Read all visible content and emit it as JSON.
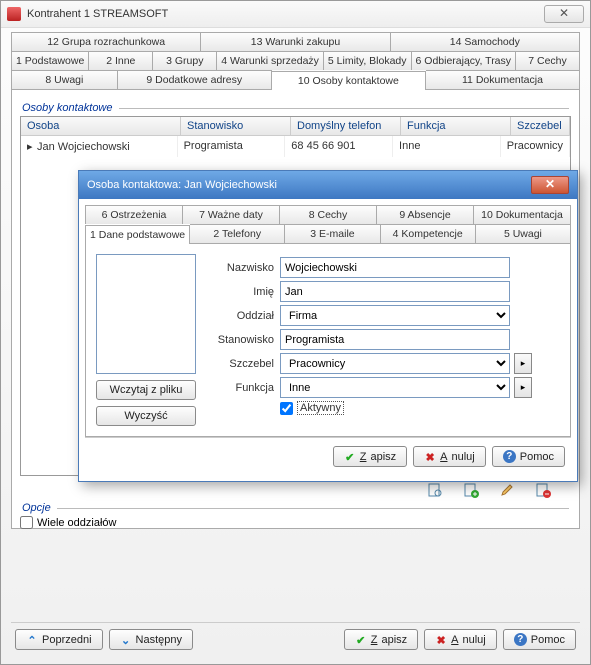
{
  "window": {
    "title": "Kontrahent  1  STREAMSOFT"
  },
  "tabs_row1": [
    "12 Grupa rozrachunkowa",
    "13 Warunki zakupu",
    "14 Samochody"
  ],
  "tabs_row2": [
    "1 Podstawowe",
    "2 Inne",
    "3 Grupy",
    "4 Warunki sprzedaży",
    "5 Limity, Blokady",
    "6 Odbierający, Trasy",
    "7 Cechy"
  ],
  "tabs_row3": [
    "8 Uwagi",
    "9 Dodatkowe adresy",
    "10 Osoby kontaktowe",
    "11 Dokumentacja"
  ],
  "tabs_row3_active": 2,
  "group_contacts": "Osoby kontaktowe",
  "grid": {
    "headers": [
      "Osoba",
      "Stanowisko",
      "Domyślny telefon",
      "Funkcja",
      "Szczebel"
    ],
    "row": [
      "Jan Wojciechowski",
      "Programista",
      "68 45 66 901",
      "Inne",
      "Pracownicy"
    ]
  },
  "toolbar_icons": [
    "view-icon",
    "add-icon",
    "edit-icon",
    "delete-icon"
  ],
  "group_options": "Opcje",
  "checkbox_multi": "Wiele oddziałów",
  "footer": {
    "prev": "Poprzedni",
    "next": "Następny",
    "save": "Zapisz",
    "cancel": "Anuluj",
    "help": "Pomoc"
  },
  "modal": {
    "title": "Osoba kontaktowa: Jan Wojciechowski",
    "tabs_row1": [
      "6 Ostrzeżenia",
      "7 Ważne daty",
      "8 Cechy",
      "9 Absencje",
      "10 Dokumentacja"
    ],
    "tabs_row2": [
      "1 Dane podstawowe",
      "2 Telefony",
      "3 E-maile",
      "4 Kompetencje",
      "5 Uwagi"
    ],
    "tabs_row2_active": 0,
    "btn_load": "Wczytaj z pliku",
    "btn_clear": "Wyczyść",
    "fields": {
      "nazwisko_label": "Nazwisko",
      "nazwisko": "Wojciechowski",
      "imie_label": "Imię",
      "imie": "Jan",
      "oddzial_label": "Oddział",
      "oddzial": "Firma",
      "stanowisko_label": "Stanowisko",
      "stanowisko": "Programista",
      "szczebel_label": "Szczebel",
      "szczebel": "Pracownicy",
      "funkcja_label": "Funkcja",
      "funkcja": "Inne",
      "aktywny_label": "Aktywny",
      "aktywny": true
    },
    "footer": {
      "save": "Zapisz",
      "cancel": "Anuluj",
      "help": "Pomoc"
    }
  }
}
